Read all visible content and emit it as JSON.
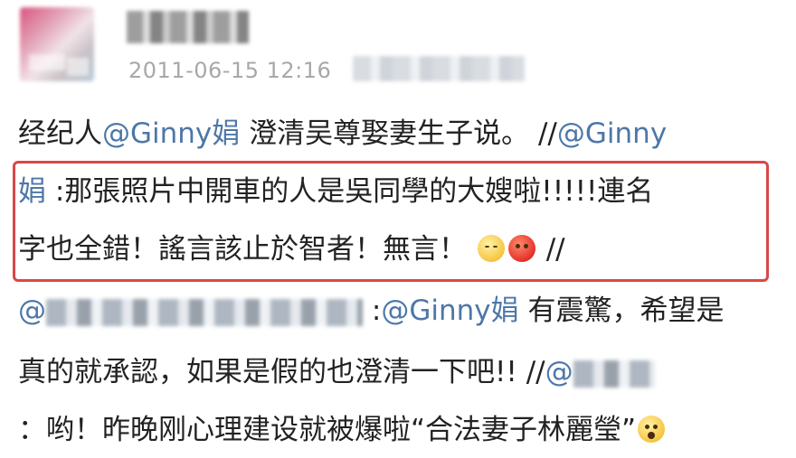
{
  "post": {
    "timestamp": "2011-06-15 12:16",
    "line1": {
      "text": "经纪人",
      "mention": "@Ginny娟",
      "rest": " 澄清吴尊娶妻生子说。 //",
      "mention2": "@Ginny"
    },
    "quote": {
      "line2_mention": "娟",
      "line2_text": " :那張照片中開車的人是吳同學的大嫂啦!!!!!連名",
      "line3_text": "字也全錯！謠言該止於智者！無言！",
      "line3_tail": " //"
    },
    "line4": {
      "at": "@",
      "text": ":",
      "mention": "@Ginny娟",
      "rest": " 有震驚，希望是"
    },
    "line5": {
      "text": "真的就承認，如果是假的也澄清一下吧!! //",
      "at": "@"
    },
    "line6": {
      "text": "：哟！昨晚刚心理建设就被爆啦“合法妻子林麗瑩”"
    }
  },
  "icons": [
    "sleepy-face-icon",
    "angry-face-icon",
    "shocked-face-icon"
  ],
  "colors": {
    "mention": "#4d77a8",
    "highlight_border": "#d94747",
    "timestamp": "#a8a8a8"
  }
}
